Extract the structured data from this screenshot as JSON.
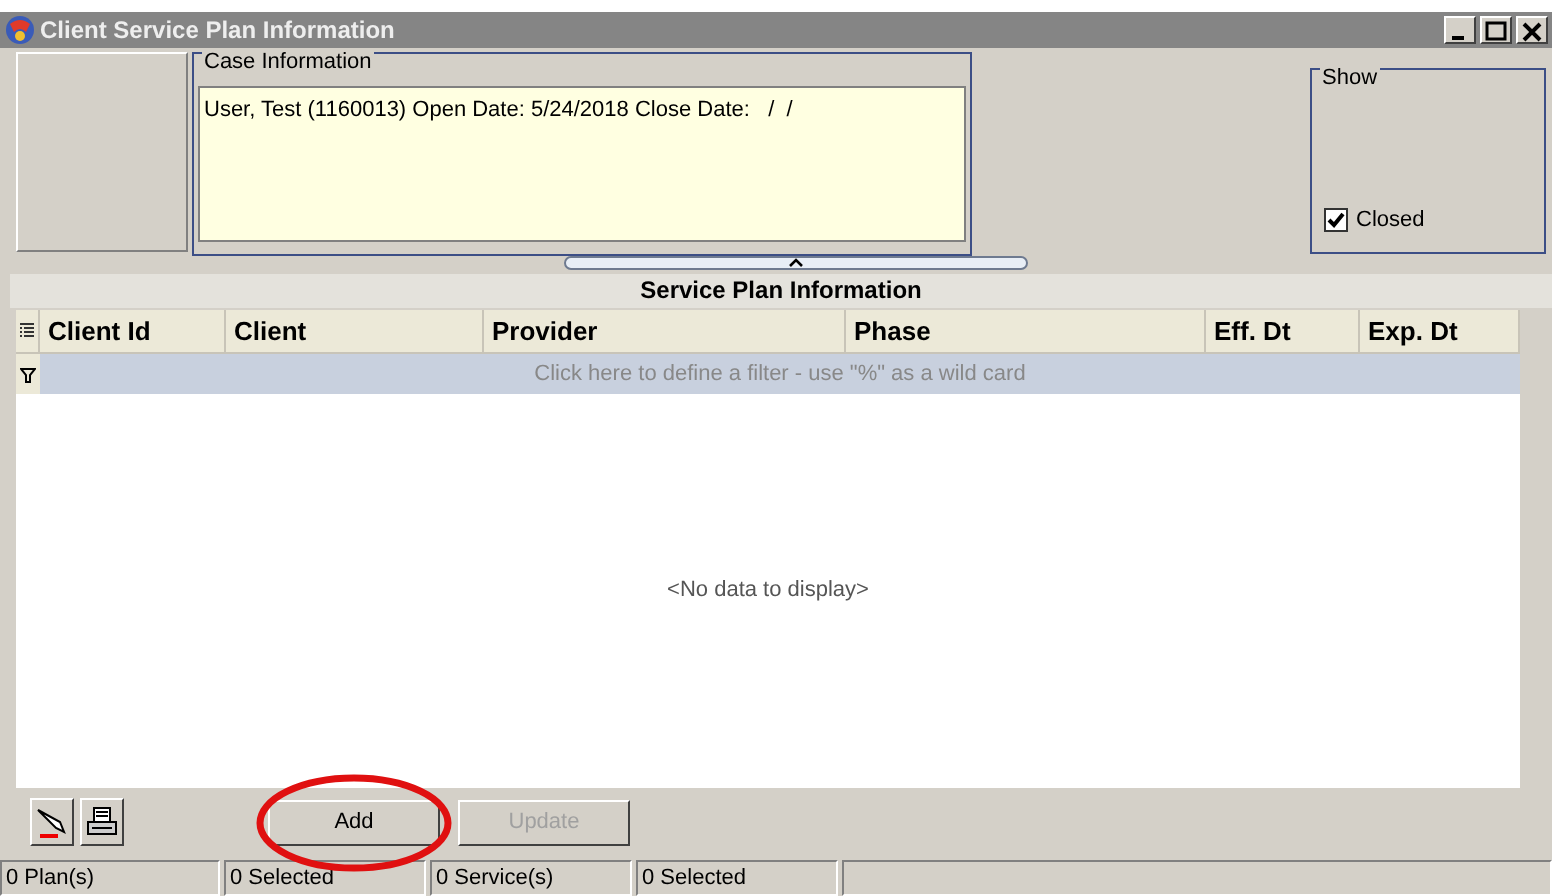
{
  "window": {
    "title": "Client Service Plan Information"
  },
  "case_information": {
    "legend": "Case Information",
    "text": "User, Test (1160013) Open Date: 5/24/2018 Close Date:   /  /"
  },
  "show": {
    "legend": "Show",
    "checkbox": {
      "label": "Closed",
      "checked": true
    }
  },
  "grid": {
    "title": "Service Plan Information",
    "columns": [
      "Client Id",
      "Client",
      "Provider",
      "Phase",
      "Eff. Dt",
      "Exp. Dt"
    ],
    "filter_hint": "Click here to define a filter - use \"%\" as a wild card",
    "empty_text": "<No data to display>"
  },
  "buttons": [
    {
      "label": "Add",
      "disabled": false,
      "highlighted": true
    },
    {
      "label": "Update",
      "disabled": true,
      "highlighted": false
    }
  ],
  "status_bar": [
    "0 Plan(s)",
    "0 Selected",
    "0 Service(s)",
    "0 Selected"
  ]
}
